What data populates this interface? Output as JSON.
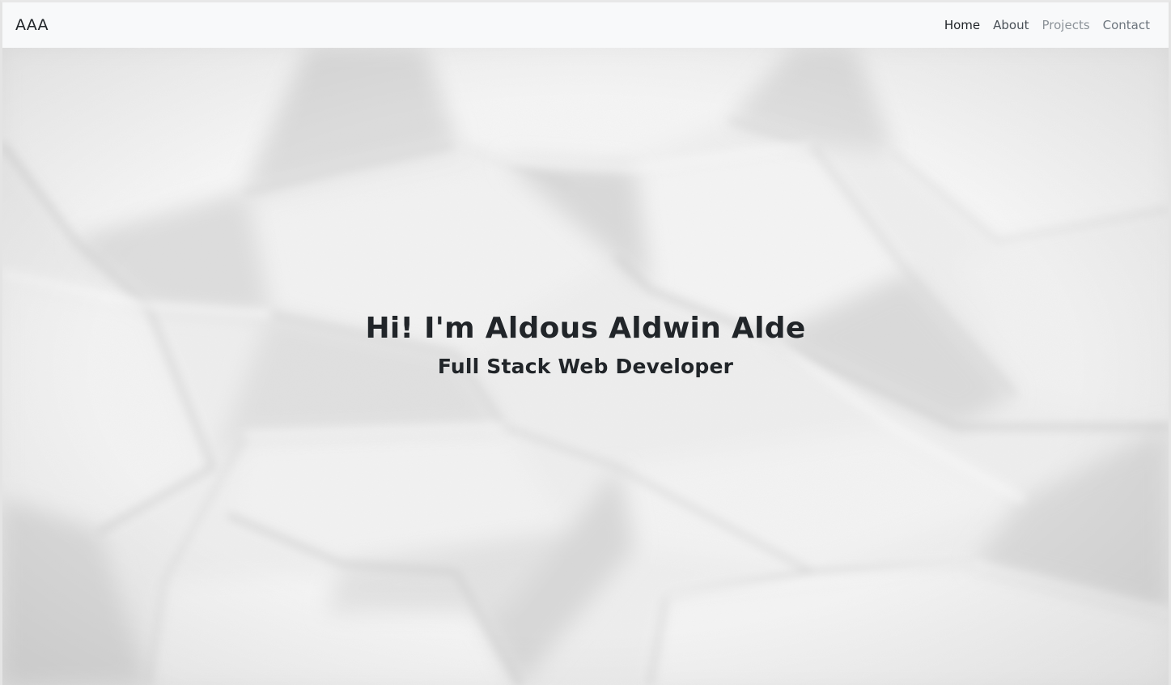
{
  "navbar": {
    "brand": "AAA",
    "links": [
      {
        "label": "Home",
        "active": true
      },
      {
        "label": "About",
        "active": false
      },
      {
        "label": "Projects",
        "active": false
      },
      {
        "label": "Contact",
        "active": false
      }
    ]
  },
  "hero": {
    "title": "Hi! I'm Aldous Aldwin Alde",
    "subtitle": "Full Stack Web Developer",
    "background": "crumpled-paper-texture"
  },
  "colors": {
    "navbar_bg": "#f8f9fa",
    "text_dark": "#212529",
    "nav_muted": "#6c757d"
  }
}
